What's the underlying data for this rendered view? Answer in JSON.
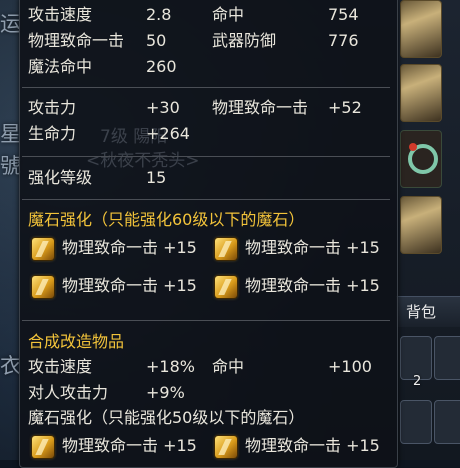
{
  "section1": {
    "rows": [
      {
        "l1": "攻击速度",
        "v1": "2.8",
        "l2": "命中",
        "v2": "754"
      },
      {
        "l1": "物理致命一击",
        "v1": "50",
        "l2": "武器防御",
        "v2": "776"
      },
      {
        "l1": "魔法命中",
        "v1": "260"
      }
    ]
  },
  "section2": {
    "rows": [
      {
        "l1": "攻击力",
        "v1": "+30",
        "l2": "物理致命一击",
        "v2": "+52"
      },
      {
        "l1": "生命力",
        "v1": "+264"
      }
    ]
  },
  "enhance": {
    "label": "强化等级",
    "value": "15"
  },
  "manastone1": {
    "title": "魔石强化（只能强化60级以下的魔石）",
    "slots": [
      {
        "text": "物理致命一击 +15"
      },
      {
        "text": "物理致命一击 +15"
      },
      {
        "text": "物理致命一击 +15"
      },
      {
        "text": "物理致命一击 +15"
      }
    ]
  },
  "fusion": {
    "title": "合成改造物品",
    "rows": [
      {
        "l1": "攻击速度",
        "v1": "+18%",
        "l2": "命中",
        "v2": "+100"
      },
      {
        "l1": "对人攻击力",
        "v1": "+9%"
      }
    ],
    "manastone_title": "魔石强化（只能强化50级以下的魔石）",
    "slots": [
      {
        "text": "物理致命一击 +15"
      },
      {
        "text": "物理致命一击 +15"
      }
    ]
  },
  "background_text": {
    "ghost1": "7级 陽阳",
    "ghost2": "<秋夜不秃头>"
  },
  "inventory": {
    "title": "背包",
    "item_count": "2"
  },
  "colors": {
    "gold": "#f2c33a",
    "text": "#e9e6dc",
    "panel_bg": "#0e1218"
  }
}
